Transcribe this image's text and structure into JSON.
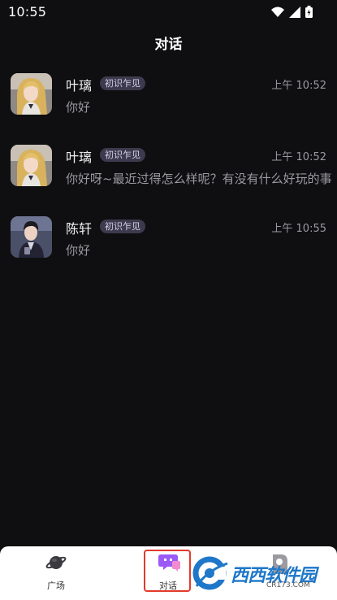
{
  "status_bar": {
    "time": "10:55",
    "icons": [
      "wifi-icon",
      "signal-icon",
      "battery-icon"
    ]
  },
  "header": {
    "title": "对话"
  },
  "conversations": [
    {
      "name": "叶璃",
      "badge": "初识乍见",
      "time": "上午 10:52",
      "preview": "你好",
      "avatar": "female-character-avatar"
    },
    {
      "name": "叶璃",
      "badge": "初识乍见",
      "time": "上午 10:52",
      "preview": "你好呀~最近过得怎么样呢？有没有什么好玩的事",
      "avatar": "female-character-avatar"
    },
    {
      "name": "陈轩",
      "badge": "初识乍见",
      "time": "上午 10:55",
      "preview": "你好",
      "avatar": "male-character-avatar"
    }
  ],
  "bottom_nav": {
    "items": [
      {
        "label": "广场",
        "icon": "planet-icon"
      },
      {
        "label": "对话",
        "icon": "chat-bubbles-icon",
        "active": true
      },
      {
        "label": "",
        "icon": "profile-icon"
      }
    ]
  },
  "watermark": {
    "brand": "西西软件园",
    "url": "CR173.COM"
  },
  "colors": {
    "background": "#0f0f11",
    "badge_bg": "#3d3a4d",
    "active_nav": "#9b59f5",
    "highlight": "#e23a2a"
  }
}
